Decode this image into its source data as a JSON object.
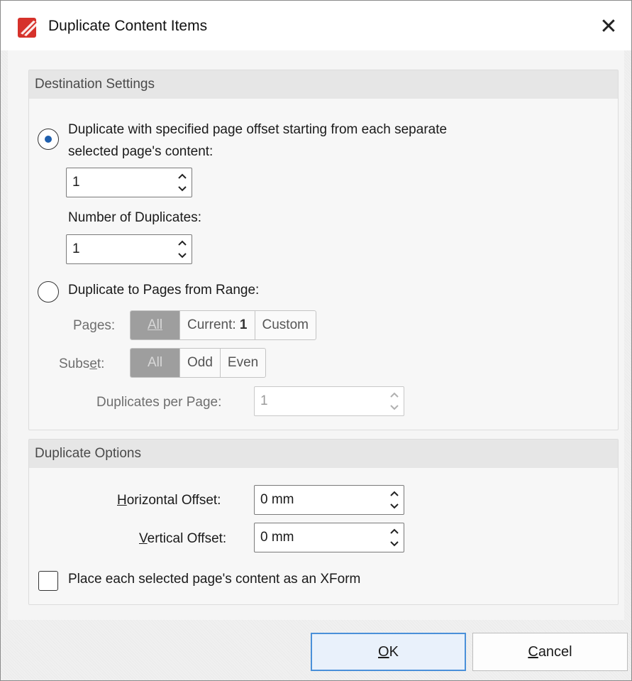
{
  "window": {
    "title": "Duplicate Content Items",
    "close_glyph": "✕"
  },
  "destination": {
    "header": "Destination Settings",
    "offset_radio_label_line1": "Duplicate with specified page offset starting from each separate",
    "offset_radio_label_line2": "selected page's content:",
    "offset_value": "1",
    "num_duplicates_label": "Number of Duplicates:",
    "num_duplicates_value": "1",
    "range_radio_label": "Duplicate to Pages from Range:",
    "pages_label": "Pages:",
    "pages_options": {
      "all": "All",
      "current_prefix": "Current: ",
      "current_value": "1",
      "custom": "Custom"
    },
    "subset_label": "Subset:",
    "subset_options": {
      "all": "All",
      "odd": "Odd",
      "even": "Even"
    },
    "dup_per_page_label": "Duplicates per Page:",
    "dup_per_page_value": "1",
    "selected_mode": "offset"
  },
  "options": {
    "header": "Duplicate Options",
    "h_offset_label": "Horizontal Offset:",
    "h_offset_value": "0 mm",
    "v_offset_label": "Vertical Offset:",
    "v_offset_value": "0 mm",
    "xform_label": "Place each selected page's content as an XForm",
    "xform_checked": false
  },
  "footer": {
    "ok_label": "OK",
    "cancel_label": "Cancel"
  },
  "colors": {
    "accent": "#1f5fad",
    "icon_red": "#d6322b",
    "ok_border": "#4a90d9"
  }
}
